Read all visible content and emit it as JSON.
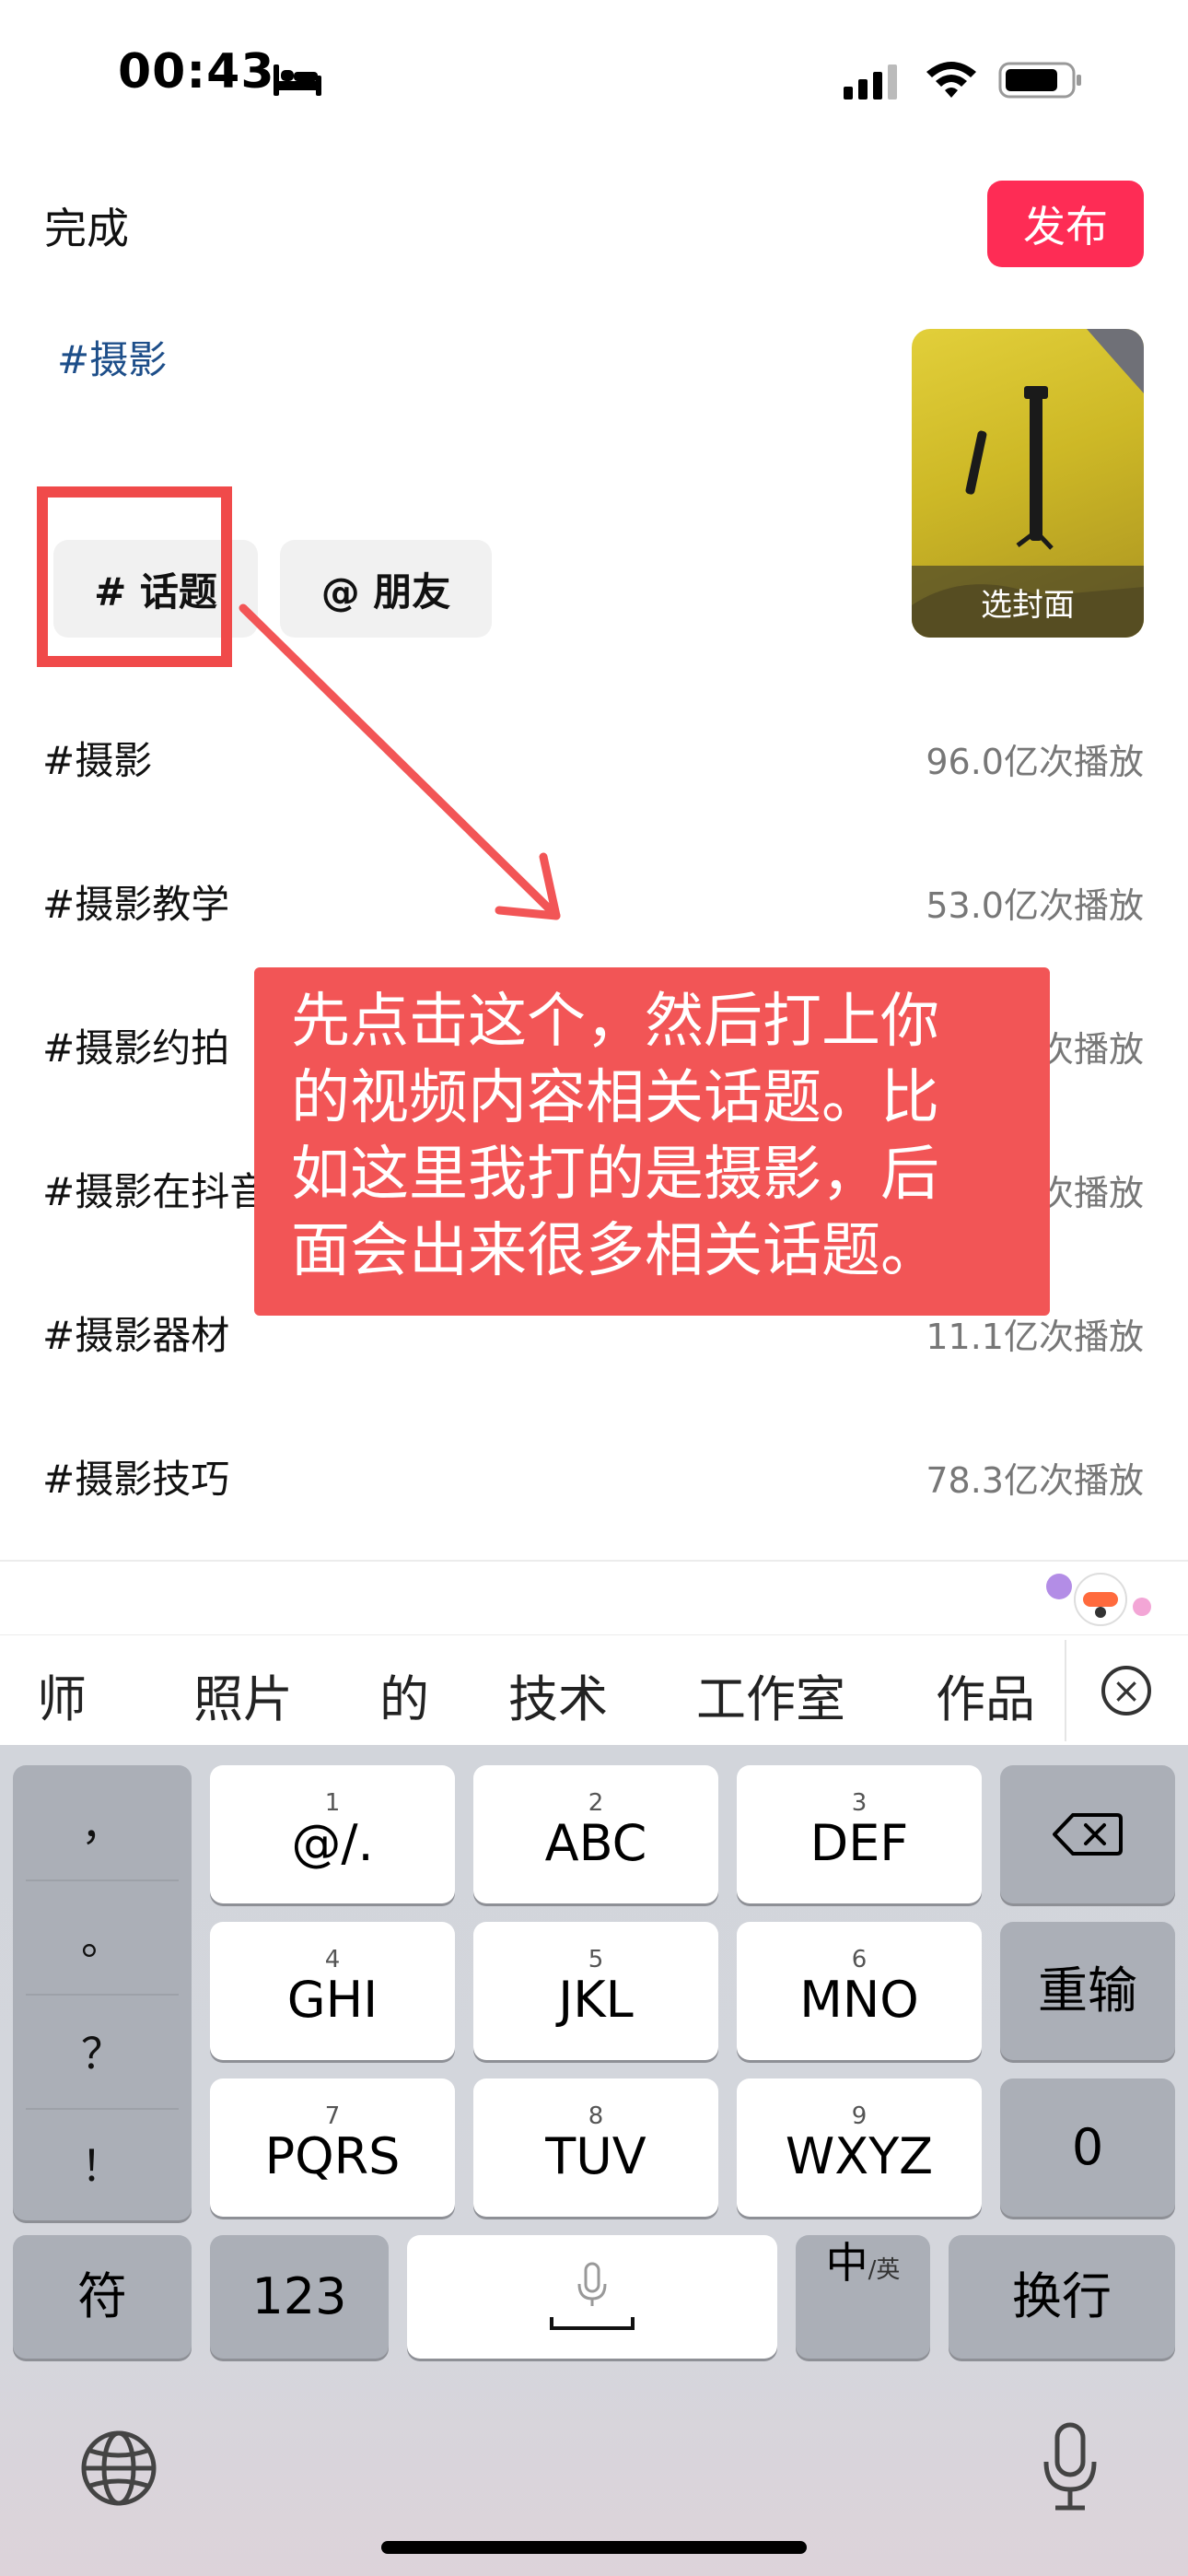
{
  "status_bar": {
    "time": "00:43"
  },
  "header": {
    "done_label": "完成",
    "publish_label": "发布"
  },
  "caption": {
    "text": "#摄影"
  },
  "cover": {
    "label": "选封面"
  },
  "chips": {
    "topic_label": "# 话题",
    "friend_label": "@ 朋友"
  },
  "topics": [
    {
      "name": "#摄影",
      "count": "96.0亿次播放"
    },
    {
      "name": "#摄影教学",
      "count": "53.0亿次播放"
    },
    {
      "name": "#摄影约拍",
      "count": "次播放"
    },
    {
      "name": "#摄影在抖音",
      "count": "次播放"
    },
    {
      "name": "#摄影器材",
      "count": "11.1亿次播放"
    },
    {
      "name": "#摄影技巧",
      "count": "78.3亿次播放"
    }
  ],
  "callout": {
    "lines": [
      "先点击这个，然后打上你",
      "的视频内容相关话题。比",
      "如这里我打的是摄影，后",
      "面会出来很多相关话题。"
    ]
  },
  "candidates": [
    "师",
    "照片",
    "的",
    "技术",
    "工作室",
    "作品"
  ],
  "candidate_close": "⊗",
  "keyboard": {
    "punct": [
      "，",
      "。",
      "？",
      "！"
    ],
    "keys": [
      {
        "num": "1",
        "label": "@/."
      },
      {
        "num": "2",
        "label": "ABC"
      },
      {
        "num": "3",
        "label": "DEF"
      },
      {
        "num": "4",
        "label": "GHI"
      },
      {
        "num": "5",
        "label": "JKL"
      },
      {
        "num": "6",
        "label": "MNO"
      },
      {
        "num": "7",
        "label": "PQRS"
      },
      {
        "num": "8",
        "label": "TUV"
      },
      {
        "num": "9",
        "label": "WXYZ"
      }
    ],
    "reenter": "重输",
    "zero": "0",
    "symbols": "符",
    "numbers": "123",
    "lang_main": "中",
    "lang_sub": "/英",
    "return": "换行"
  },
  "icons": {
    "bed": "bed-icon",
    "signal": "cellular-signal-icon",
    "wifi": "wifi-icon",
    "battery": "battery-icon",
    "backspace": "backspace-icon",
    "mic": "microphone-icon",
    "globe": "globe-icon"
  },
  "colors": {
    "publish": "#fe2c55",
    "callout": "#f25556",
    "highlight_box": "#f04a4a",
    "caption": "#1d4e89"
  }
}
